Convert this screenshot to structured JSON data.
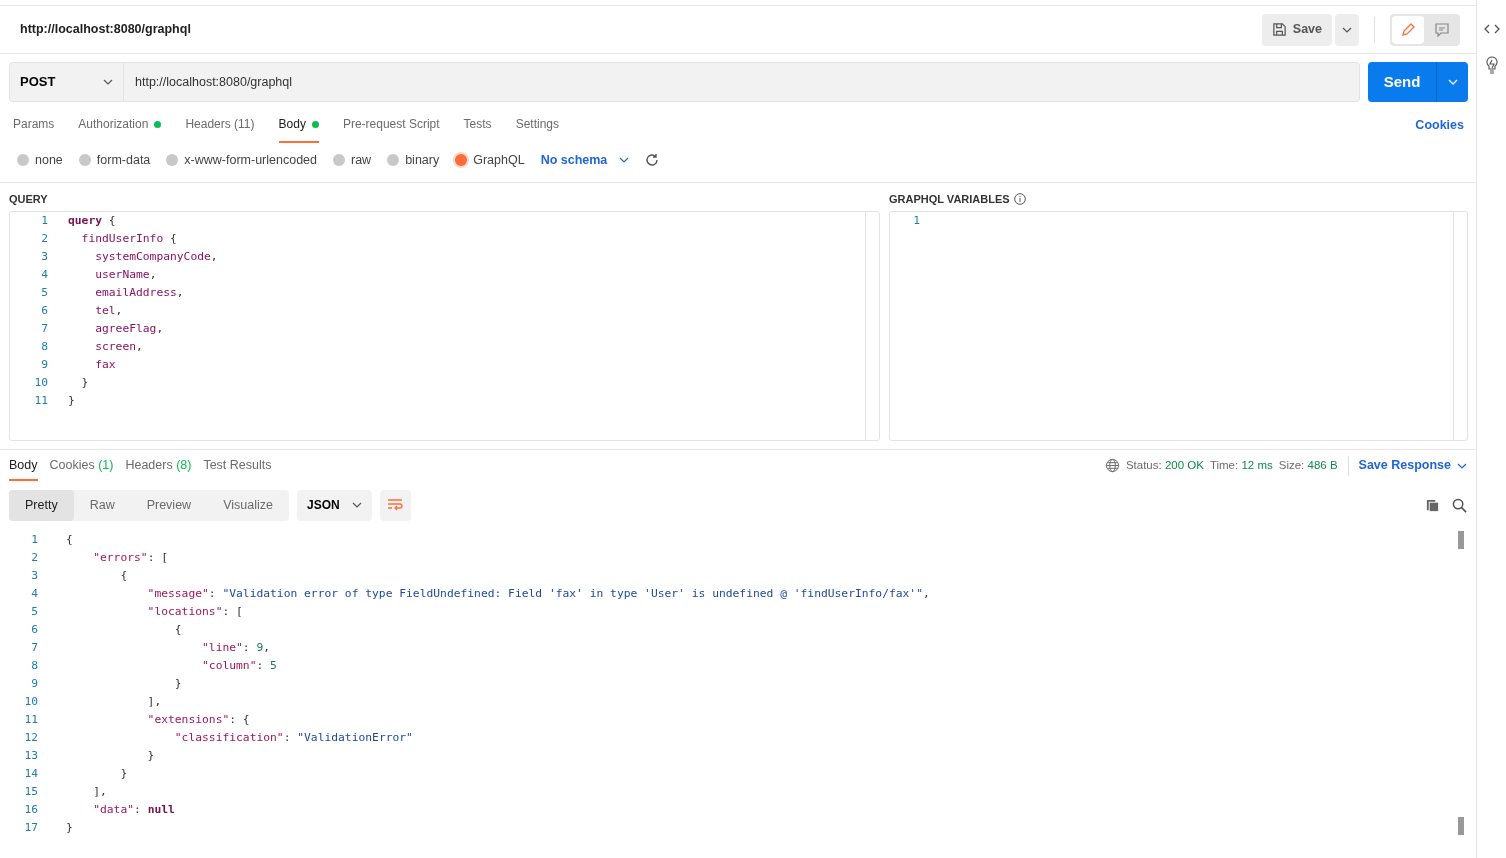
{
  "request_title": "http://localhost:8080/graphql",
  "header_buttons": {
    "save": "Save"
  },
  "request": {
    "method": "POST",
    "url": "http://localhost:8080/graphql",
    "send": "Send"
  },
  "request_tabs": [
    {
      "label": "Params",
      "indicator": false,
      "selected": false
    },
    {
      "label": "Authorization",
      "indicator": true,
      "selected": false
    },
    {
      "label": "Headers",
      "count": "(11)",
      "indicator": false,
      "selected": false
    },
    {
      "label": "Body",
      "indicator": true,
      "selected": true
    },
    {
      "label": "Pre-request Script",
      "indicator": false,
      "selected": false
    },
    {
      "label": "Tests",
      "indicator": false,
      "selected": false
    },
    {
      "label": "Settings",
      "indicator": false,
      "selected": false
    }
  ],
  "cookies_link": "Cookies",
  "body_types": [
    {
      "label": "none",
      "selected": false
    },
    {
      "label": "form-data",
      "selected": false
    },
    {
      "label": "x-www-form-urlencoded",
      "selected": false
    },
    {
      "label": "raw",
      "selected": false
    },
    {
      "label": "binary",
      "selected": false
    },
    {
      "label": "GraphQL",
      "selected": true
    }
  ],
  "schema": "No schema",
  "query": {
    "label": "QUERY",
    "lines": [
      {
        "number": "1",
        "tokens": [
          {
            "kind": "keyword",
            "text": "query"
          },
          {
            "kind": "punct",
            "text": " {"
          }
        ]
      },
      {
        "number": "2",
        "tokens": [
          {
            "kind": "field",
            "text": "  findUserInfo"
          },
          {
            "kind": "punct",
            "text": " {"
          }
        ]
      },
      {
        "number": "3",
        "tokens": [
          {
            "kind": "field",
            "text": "    systemCompanyCode"
          },
          {
            "kind": "punct",
            "text": ","
          }
        ]
      },
      {
        "number": "4",
        "tokens": [
          {
            "kind": "field",
            "text": "    userName"
          },
          {
            "kind": "punct",
            "text": ","
          }
        ]
      },
      {
        "number": "5",
        "tokens": [
          {
            "kind": "field",
            "text": "    emailAddress"
          },
          {
            "kind": "punct",
            "text": ","
          }
        ]
      },
      {
        "number": "6",
        "tokens": [
          {
            "kind": "field",
            "text": "    tel"
          },
          {
            "kind": "punct",
            "text": ","
          }
        ]
      },
      {
        "number": "7",
        "tokens": [
          {
            "kind": "field",
            "text": "    agreeFlag"
          },
          {
            "kind": "punct",
            "text": ","
          }
        ]
      },
      {
        "number": "8",
        "tokens": [
          {
            "kind": "field",
            "text": "    screen"
          },
          {
            "kind": "punct",
            "text": ","
          }
        ]
      },
      {
        "number": "9",
        "tokens": [
          {
            "kind": "field",
            "text": "    fax"
          }
        ]
      },
      {
        "number": "10",
        "tokens": [
          {
            "kind": "punct",
            "text": "  }"
          }
        ]
      },
      {
        "number": "11",
        "tokens": [
          {
            "kind": "punct",
            "text": "}"
          }
        ]
      }
    ]
  },
  "variables": {
    "label": "GRAPHQL VARIABLES",
    "lines": [
      {
        "number": "1"
      }
    ]
  },
  "response_tabs": [
    {
      "label": "Body",
      "selected": true
    },
    {
      "label": "Cookies",
      "count": "(1)",
      "selected": false
    },
    {
      "label": "Headers",
      "count": "(8)",
      "selected": false
    },
    {
      "label": "Test Results",
      "selected": false
    }
  ],
  "response_stats": [
    {
      "label": "Status:",
      "value": "200 OK"
    },
    {
      "label": "Time:",
      "value": "12 ms"
    },
    {
      "label": "Size:",
      "value": "486 B"
    }
  ],
  "save_response": "Save Response",
  "view_modes": [
    {
      "label": "Pretty",
      "selected": true
    },
    {
      "label": "Raw",
      "selected": false
    },
    {
      "label": "Preview",
      "selected": false
    },
    {
      "label": "Visualize",
      "selected": false
    }
  ],
  "format": "JSON",
  "response_lines": [
    {
      "number": "1",
      "tokens": [
        {
          "kind": "punct",
          "text": "{"
        }
      ]
    },
    {
      "number": "2",
      "tokens": [
        {
          "kind": "key",
          "text": "    \"errors\""
        },
        {
          "kind": "punct",
          "text": ": ["
        }
      ]
    },
    {
      "number": "3",
      "tokens": [
        {
          "kind": "punct",
          "text": "        {"
        }
      ]
    },
    {
      "number": "4",
      "tokens": [
        {
          "kind": "key",
          "text": "            \"message\""
        },
        {
          "kind": "punct",
          "text": ": "
        },
        {
          "kind": "string",
          "text": "\"Validation error of type FieldUndefined: Field 'fax' in type 'User' is undefined @ 'findUserInfo/fax'\""
        },
        {
          "kind": "punct",
          "text": ","
        }
      ]
    },
    {
      "number": "5",
      "tokens": [
        {
          "kind": "key",
          "text": "            \"locations\""
        },
        {
          "kind": "punct",
          "text": ": ["
        }
      ]
    },
    {
      "number": "6",
      "tokens": [
        {
          "kind": "punct",
          "text": "                {"
        }
      ]
    },
    {
      "number": "7",
      "tokens": [
        {
          "kind": "key",
          "text": "                    \"line\""
        },
        {
          "kind": "punct",
          "text": ": "
        },
        {
          "kind": "number",
          "text": "9"
        },
        {
          "kind": "punct",
          "text": ","
        }
      ]
    },
    {
      "number": "8",
      "tokens": [
        {
          "kind": "key",
          "text": "                    \"column\""
        },
        {
          "kind": "punct",
          "text": ": "
        },
        {
          "kind": "number",
          "text": "5"
        }
      ]
    },
    {
      "number": "9",
      "tokens": [
        {
          "kind": "punct",
          "text": "                }"
        }
      ]
    },
    {
      "number": "10",
      "tokens": [
        {
          "kind": "punct",
          "text": "            ],"
        }
      ]
    },
    {
      "number": "11",
      "tokens": [
        {
          "kind": "key",
          "text": "            \"extensions\""
        },
        {
          "kind": "punct",
          "text": ": {"
        }
      ]
    },
    {
      "number": "12",
      "tokens": [
        {
          "kind": "key",
          "text": "                \"classification\""
        },
        {
          "kind": "punct",
          "text": ": "
        },
        {
          "kind": "string",
          "text": "\"ValidationError\""
        }
      ]
    },
    {
      "number": "13",
      "tokens": [
        {
          "kind": "punct",
          "text": "            }"
        }
      ]
    },
    {
      "number": "14",
      "tokens": [
        {
          "kind": "punct",
          "text": "        }"
        }
      ]
    },
    {
      "number": "15",
      "tokens": [
        {
          "kind": "punct",
          "text": "    ],"
        }
      ]
    },
    {
      "number": "16",
      "tokens": [
        {
          "kind": "key",
          "text": "    \"data\""
        },
        {
          "kind": "punct",
          "text": ": "
        },
        {
          "kind": "keyword",
          "text": "null"
        }
      ]
    },
    {
      "number": "17",
      "tokens": [
        {
          "kind": "punct",
          "text": "}"
        }
      ]
    }
  ]
}
